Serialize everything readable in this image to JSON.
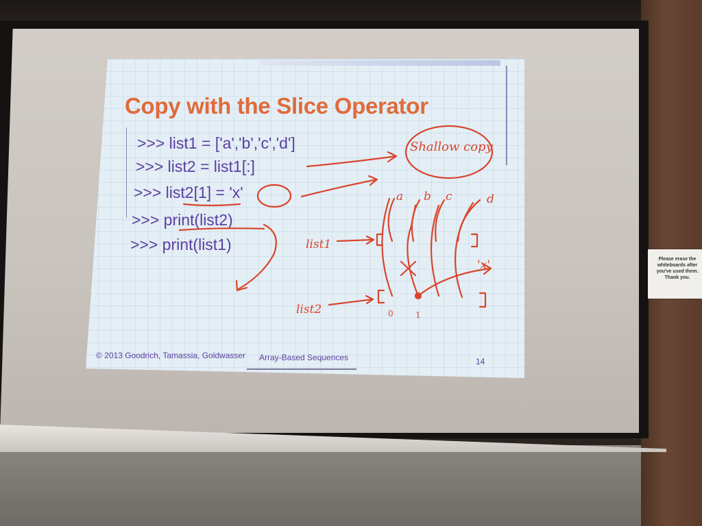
{
  "slide": {
    "title": "Copy with the Slice Operator",
    "code_lines": [
      ">>> list1 = ['a','b','c','d']",
      ">>> list2 = list1[:]",
      ">>> list2[1] = 'x'",
      ">>> print(list2)",
      ">>> print(list1)"
    ],
    "footer_copyright": "© 2013 Goodrich, Tamassia, Goldwasser",
    "footer_section": "Array-Based Sequences",
    "page_number": "14"
  },
  "annotations": {
    "shallow_copy": "Shallow copy",
    "list1_label": "list1",
    "list2_label": "list2",
    "elements": [
      "a",
      "b",
      "c",
      "d"
    ],
    "new_value": "'x'",
    "index_0": "0",
    "index_1": "1"
  },
  "wall_sign": {
    "text": "Please erase the whiteboards after you've used them. Thank you."
  },
  "colors": {
    "title": "#e06b3a",
    "code": "#5a3fa0",
    "ink": "#d9452c",
    "slide_bg": "#e4eef5"
  }
}
